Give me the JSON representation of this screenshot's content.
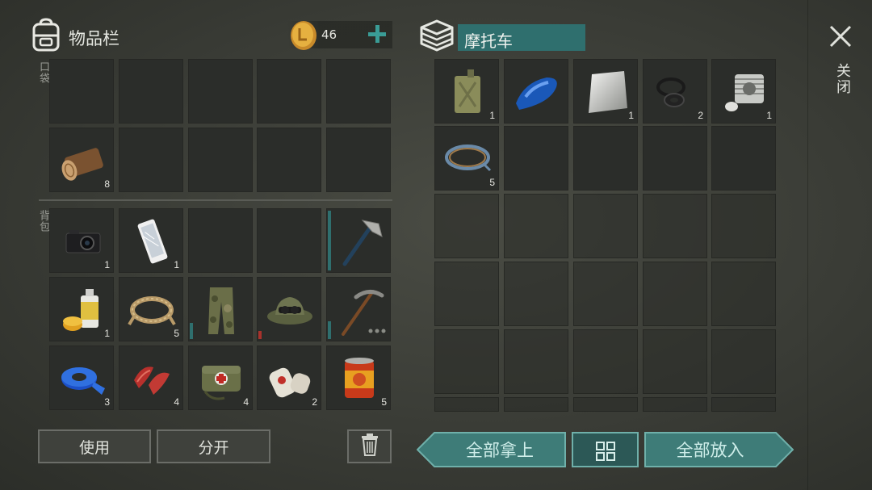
{
  "inventory": {
    "title": "物品栏",
    "coins": "46",
    "pocket_label": "口袋",
    "backpack_label": "背包",
    "pocket_items": [
      {
        "name": "log",
        "count": "8"
      }
    ],
    "backpack_items": [
      {
        "name": "camera",
        "count": "1"
      },
      {
        "name": "smartphone",
        "count": "1"
      },
      {
        "name": "axe",
        "count": ""
      },
      {
        "name": "spray-paint",
        "count": "1"
      },
      {
        "name": "rope",
        "count": "5"
      },
      {
        "name": "camo-pants",
        "count": ""
      },
      {
        "name": "camo-hat",
        "count": ""
      },
      {
        "name": "pickaxe",
        "count": ""
      },
      {
        "name": "duct-tape",
        "count": "3"
      },
      {
        "name": "raw-meat",
        "count": "4"
      },
      {
        "name": "first-aid-bag",
        "count": "4"
      },
      {
        "name": "bandage",
        "count": "2"
      },
      {
        "name": "canned-food",
        "count": "5"
      }
    ],
    "use_label": "使用",
    "split_label": "分开"
  },
  "container": {
    "title": "摩托车",
    "items": [
      {
        "name": "jerrycan",
        "count": "1"
      },
      {
        "name": "fuel-tank",
        "count": ""
      },
      {
        "name": "metal-plate",
        "count": "1"
      },
      {
        "name": "gaskets",
        "count": "2"
      },
      {
        "name": "engine-cylinder",
        "count": "1"
      },
      {
        "name": "wire",
        "count": "5"
      }
    ],
    "take_all_label": "全部拿上",
    "put_all_label": "全部放入"
  },
  "close_label": "关闭",
  "colors": {
    "accent_teal": "#2f6f6e",
    "teal_button": "#3e7c78",
    "durability_red": "#a8322c"
  }
}
